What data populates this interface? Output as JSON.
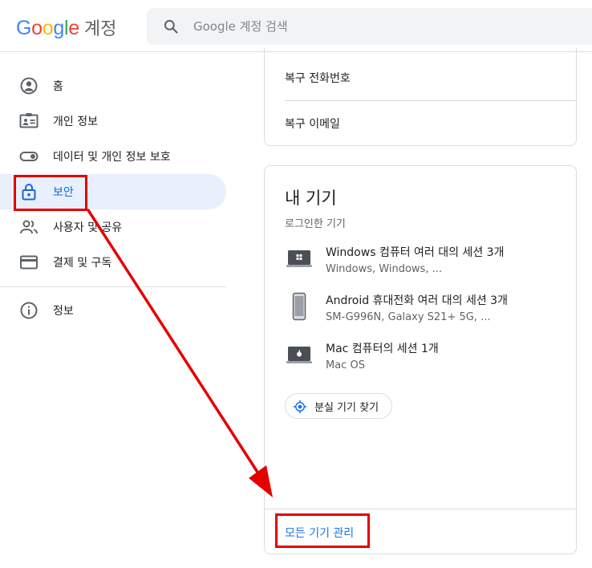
{
  "header": {
    "logo_word": "Google",
    "product": "계정",
    "search_placeholder": "Google 계정 검색"
  },
  "sidebar": {
    "items": [
      {
        "label": "홈",
        "icon": "home-icon"
      },
      {
        "label": "개인 정보",
        "icon": "id-card-icon"
      },
      {
        "label": "데이터 및 개인 정보 보호",
        "icon": "toggle-icon"
      },
      {
        "label": "보안",
        "icon": "lock-icon",
        "active": true
      },
      {
        "label": "사용자 및 공유",
        "icon": "people-icon"
      },
      {
        "label": "결제 및 구독",
        "icon": "credit-card-icon"
      }
    ],
    "info": {
      "label": "정보",
      "icon": "info-icon"
    }
  },
  "recovery_card": {
    "phone_label": "복구 전화번호",
    "email_label": "복구 이메일"
  },
  "devices_card": {
    "title": "내 기기",
    "subtitle": "로그인한 기기",
    "devices": [
      {
        "name": "Windows 컴퓨터 여러 대의 세션 3개",
        "detail": "Windows, Windows, ...",
        "icon": "windows-laptop-icon"
      },
      {
        "name": "Android 휴대전화 여러 대의 세션 3개",
        "detail": "SM-G996N, Galaxy S21+ 5G, ...",
        "icon": "android-phone-icon"
      },
      {
        "name": "Mac 컴퓨터의 세션 1개",
        "detail": "Mac OS",
        "icon": "mac-laptop-icon"
      }
    ],
    "find_button": "분실 기기 찾기",
    "manage_link": "모든 기기 관리"
  },
  "colors": {
    "accent": "#1a73e8",
    "active_bg": "#e8f0fe",
    "annotation": "#e50000"
  }
}
